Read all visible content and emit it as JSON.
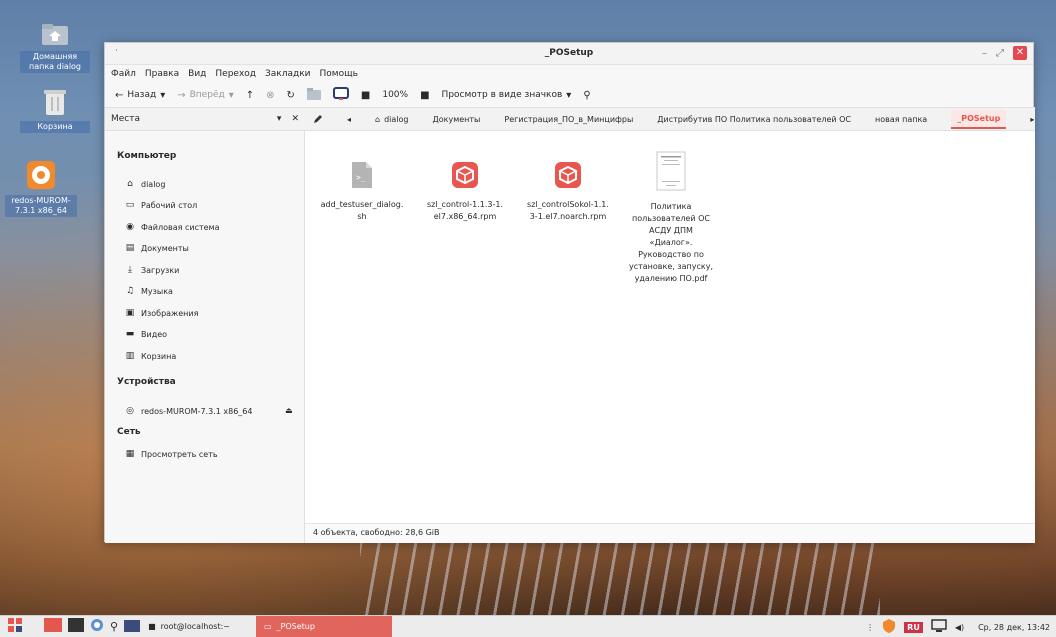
{
  "desktop": {
    "icons": [
      {
        "label": "Домашняя папка dialog"
      },
      {
        "label": "Корзина"
      },
      {
        "label": "redos-MUROM-7.3.1 x86_64"
      }
    ]
  },
  "window": {
    "title": "_POSetup",
    "dot": "·",
    "controls": {
      "minimize": "–",
      "maximize": "⤢",
      "close": "✕"
    }
  },
  "menu": [
    "Файл",
    "Правка",
    "Вид",
    "Переход",
    "Закладки",
    "Помощь"
  ],
  "toolbar": {
    "back": "Назад",
    "forward": "Вперёд",
    "zoom": "100%",
    "view_mode": "Просмотр в виде значков"
  },
  "places_label": "Места",
  "breadcrumbs": [
    {
      "label": "dialog"
    },
    {
      "label": "Документы"
    },
    {
      "label": "Регистрация_ПО_в_Минцифры"
    },
    {
      "label": "Дистрибутив ПО Политика пользователей ОС"
    },
    {
      "label": "новая папка"
    },
    {
      "label": "_POSetup"
    }
  ],
  "sidebar": {
    "computer_header": "Компьютер",
    "computer_items": [
      {
        "label": "dialog",
        "icon": "home-icon"
      },
      {
        "label": "Рабочий стол",
        "icon": "desktop-icon"
      },
      {
        "label": "Файловая система",
        "icon": "filesystem-icon"
      },
      {
        "label": "Документы",
        "icon": "documents-icon"
      },
      {
        "label": "Загрузки",
        "icon": "downloads-icon"
      },
      {
        "label": "Музыка",
        "icon": "music-icon"
      },
      {
        "label": "Изображения",
        "icon": "pictures-icon"
      },
      {
        "label": "Видео",
        "icon": "video-icon"
      },
      {
        "label": "Корзина",
        "icon": "trash-icon"
      }
    ],
    "devices_header": "Устройства",
    "devices_items": [
      {
        "label": "redos-MUROM-7.3.1 x86_64",
        "icon": "disc-icon"
      }
    ],
    "network_header": "Сеть",
    "network_items": [
      {
        "label": "Просмотреть сеть",
        "icon": "network-icon"
      }
    ]
  },
  "files": [
    {
      "name_lines": [
        "add_testuser_dialog.",
        "sh"
      ],
      "type": "script"
    },
    {
      "name_lines": [
        "szl_control-1.1.3-1.",
        "el7.x86_64.rpm"
      ],
      "type": "rpm"
    },
    {
      "name_lines": [
        "szl_controlSokol-1.1.",
        "3-1.el7.noarch.rpm"
      ],
      "type": "rpm"
    },
    {
      "name_lines": [
        "Политика",
        "пользователей ОС",
        "АСДУ ДПМ",
        "«Диалог».",
        "Руководство по",
        "установке, запуску,",
        "удалению ПО.pdf"
      ],
      "type": "pdf"
    }
  ],
  "status": "4 объекта, свободно: 28,6 GiB",
  "taskbar": {
    "terminal_task": "root@localhost:~",
    "files_task": "_POSetup",
    "lang": "RU",
    "clock": "Ср, 28 дек, 13:42"
  },
  "colors": {
    "accent": "#e2584e",
    "close": "#e5474f",
    "rpm": "#e8574f"
  }
}
